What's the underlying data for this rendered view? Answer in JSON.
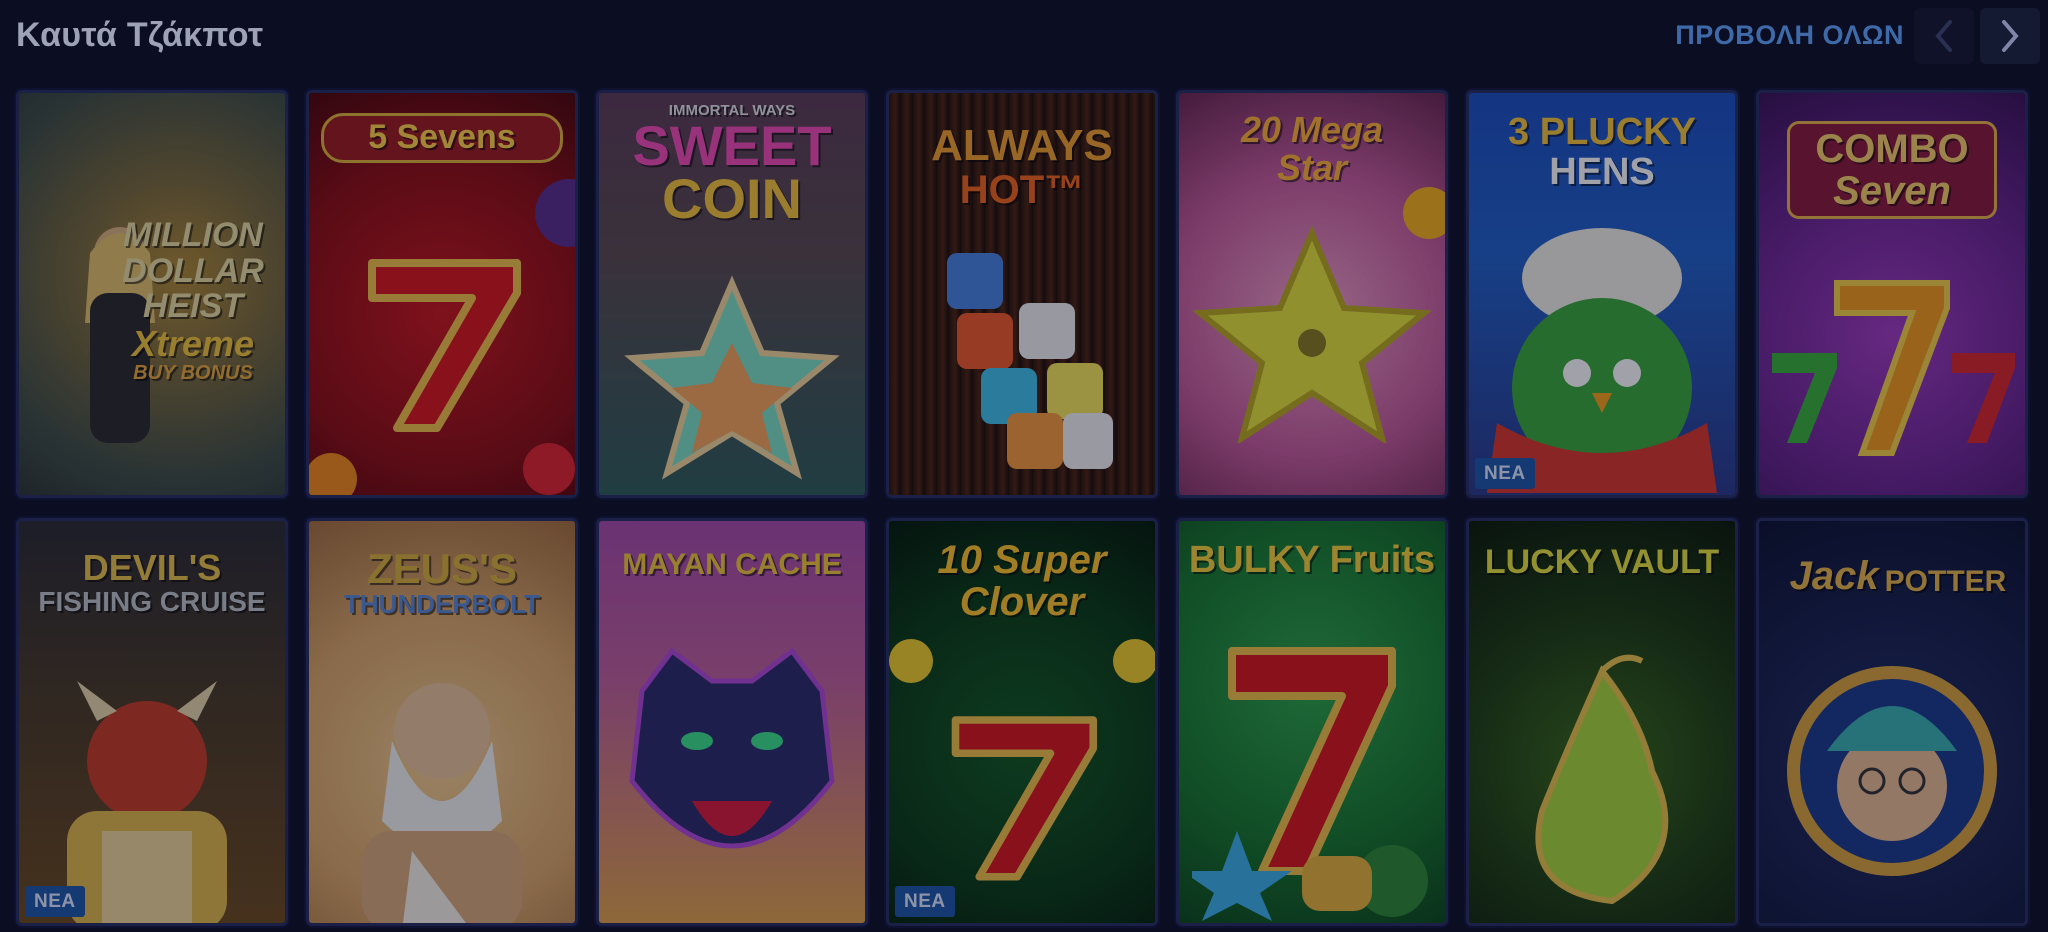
{
  "header": {
    "title": "Καυτά Τζάκποτ",
    "view_all": "ΠΡΟΒΟΛΗ ΟΛΩΝ"
  },
  "games": [
    {
      "name_lines": [
        "MILLION",
        "DOLLAR",
        "HEIST",
        "Xtreme",
        "BUY BONUS"
      ],
      "badge": "",
      "colors": [
        "#4a5a46",
        "#8b7a3e"
      ],
      "icon": "heist-figure-icon"
    },
    {
      "name_lines": [
        "5 Sevens"
      ],
      "badge": "",
      "colors": [
        "#a0181c",
        "#5c0a0e"
      ],
      "icon": "seven-icon"
    },
    {
      "name_lines": [
        "IMMORTAL WAYS",
        "SWEET",
        "COIN"
      ],
      "badge": "",
      "colors": [
        "#5b3b5a",
        "#2f5b58"
      ],
      "icon": "star-candy-icon"
    },
    {
      "name_lines": [
        "ALWAYS",
        "HOT™"
      ],
      "badge": "",
      "colors": [
        "#3b1d0f",
        "#120706"
      ],
      "icon": "dice-icon"
    },
    {
      "name_lines": [
        "20 Mega",
        "Star"
      ],
      "badge": "",
      "colors": [
        "#b2518a",
        "#5c2247"
      ],
      "icon": "star-fruit-icon"
    },
    {
      "name_lines": [
        "3 PLUCKY",
        "HENS"
      ],
      "badge": "NEA",
      "colors": [
        "#1f4aa6",
        "#1b2d6e"
      ],
      "icon": "hen-icon"
    },
    {
      "name_lines": [
        "COMBO",
        "Seven"
      ],
      "badge": "",
      "colors": [
        "#6a2a93",
        "#3b1360"
      ],
      "icon": "triple-seven-icon"
    },
    {
      "name_lines": [
        "DEVIL'S",
        "FISHING CRUISE"
      ],
      "badge": "NEA",
      "colors": [
        "#3f3320",
        "#6a4a1e"
      ],
      "icon": "devil-icon"
    },
    {
      "name_lines": [
        "ZEUS'S",
        "THUNDERBOLT"
      ],
      "badge": "",
      "colors": [
        "#9a6d3b",
        "#e0b77a"
      ],
      "icon": "zeus-icon"
    },
    {
      "name_lines": [
        "MAYAN CACHE"
      ],
      "badge": "",
      "colors": [
        "#8a4a98",
        "#c5784a"
      ],
      "icon": "panther-icon"
    },
    {
      "name_lines": [
        "10 Super",
        "Clover"
      ],
      "badge": "NEA",
      "colors": [
        "#0d4a1a",
        "#062a10"
      ],
      "icon": "seven-icon"
    },
    {
      "name_lines": [
        "BULKY Fruits"
      ],
      "badge": "",
      "colors": [
        "#1b7a2e",
        "#0d4d1e"
      ],
      "icon": "seven-fruits-icon"
    },
    {
      "name_lines": [
        "LUCKY VAULT"
      ],
      "badge": "",
      "colors": [
        "#1e3a12",
        "#0b1a07"
      ],
      "icon": "pear-icon"
    },
    {
      "name_lines": [
        "Jack",
        "POTTER"
      ],
      "badge": "",
      "colors": [
        "#1a2250",
        "#0f1535"
      ],
      "icon": "jester-icon"
    }
  ]
}
